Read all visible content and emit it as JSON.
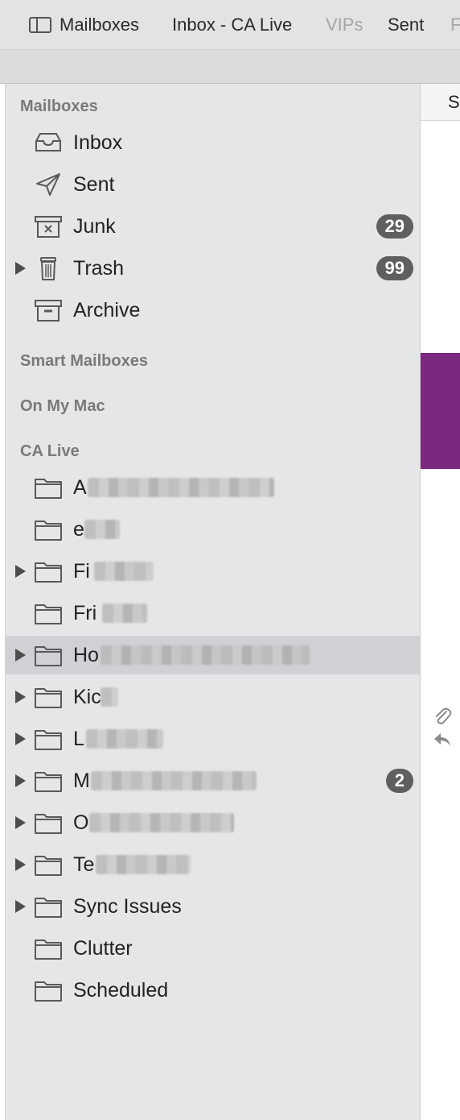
{
  "favorites_bar": {
    "items": [
      {
        "label": "Mailboxes"
      },
      {
        "label": "Inbox - CA Live"
      },
      {
        "label": "VIPs"
      },
      {
        "label": "Sent"
      },
      {
        "label": "F"
      }
    ]
  },
  "sidebar": {
    "sections": {
      "mailboxes": "Mailboxes",
      "smart": "Smart Mailboxes",
      "on_my_mac": "On My Mac",
      "account": "CA Live"
    },
    "mailboxes": [
      {
        "label": "Inbox",
        "icon": "inbox-tray-icon"
      },
      {
        "label": "Sent",
        "icon": "paper-plane-icon"
      },
      {
        "label": "Junk",
        "icon": "junk-box-icon",
        "badge": "29"
      },
      {
        "label": "Trash",
        "icon": "trash-can-icon",
        "badge": "99",
        "expandable": true
      },
      {
        "label": "Archive",
        "icon": "archive-box-icon"
      }
    ],
    "folders": [
      {
        "label": "A"
      },
      {
        "label": "e"
      },
      {
        "label": "Fi"
      },
      {
        "label": "Fri"
      },
      {
        "label": "Ho"
      },
      {
        "label": "Kic"
      },
      {
        "label": "L"
      },
      {
        "label": "M",
        "badge": "2"
      },
      {
        "label": "O"
      },
      {
        "label": "Te"
      },
      {
        "label": "Sync Issues"
      },
      {
        "label": "Clutter"
      },
      {
        "label": "Scheduled"
      }
    ]
  },
  "message_list": {
    "sort_header": "S",
    "icons": [
      "paperclip-icon",
      "reply-arrow-icon"
    ]
  },
  "colors": {
    "sidebar_bg": "#e5e6e8",
    "selected_row": "#cfd1d5",
    "badge_bg": "#5f5f5f",
    "selected_message": "#7b287f"
  }
}
